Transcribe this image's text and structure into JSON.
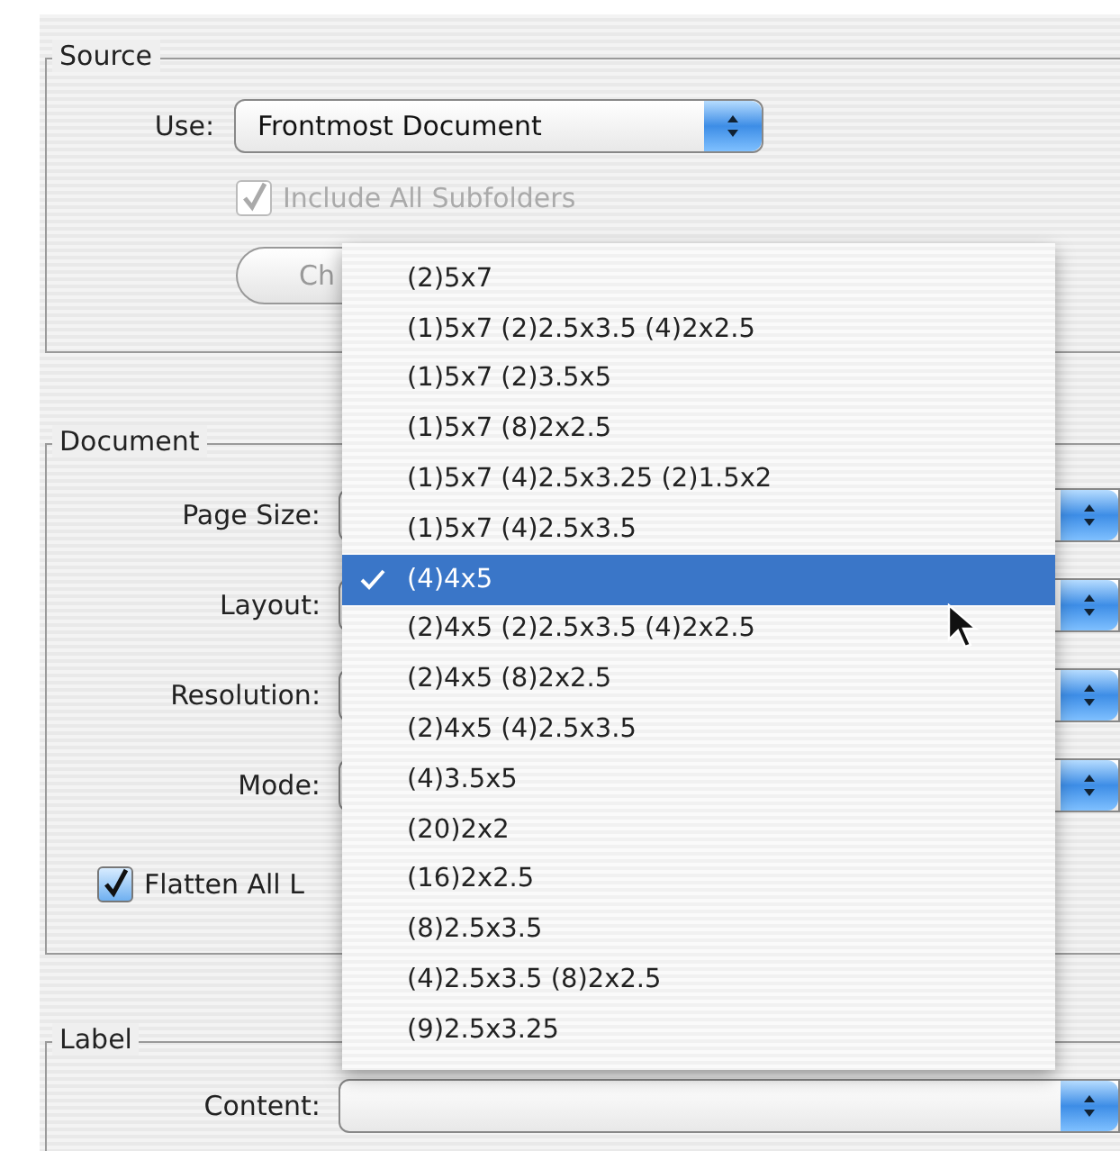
{
  "source": {
    "title": "Source",
    "use_label": "Use:",
    "use_value": "Frontmost Document",
    "include_subfolders": {
      "label": "Include All Subfolders",
      "checked": true,
      "disabled": true
    },
    "choose_button": "Ch"
  },
  "document": {
    "title": "Document",
    "fields": [
      {
        "label": "Page Size:"
      },
      {
        "label": "Layout:"
      },
      {
        "label": "Resolution:"
      },
      {
        "label": "Mode:"
      }
    ],
    "flatten": {
      "label": "Flatten All L",
      "checked": true,
      "disabled": false
    }
  },
  "label_group": {
    "title": "Label",
    "fields": [
      {
        "label": "Content:"
      }
    ]
  },
  "layout_menu": {
    "items": [
      {
        "label": "(2)5x7",
        "selected": false
      },
      {
        "label": "(1)5x7 (2)2.5x3.5 (4)2x2.5",
        "selected": false
      },
      {
        "label": "(1)5x7 (2)3.5x5",
        "selected": false
      },
      {
        "label": "(1)5x7 (8)2x2.5",
        "selected": false
      },
      {
        "label": "(1)5x7 (4)2.5x3.25 (2)1.5x2",
        "selected": false
      },
      {
        "label": "(1)5x7 (4)2.5x3.5",
        "selected": false
      },
      {
        "label": "(4)4x5",
        "selected": true
      },
      {
        "label": "(2)4x5 (2)2.5x3.5 (4)2x2.5",
        "selected": false
      },
      {
        "label": "(2)4x5 (8)2x2.5",
        "selected": false
      },
      {
        "label": "(2)4x5 (4)2.5x3.5",
        "selected": false
      },
      {
        "label": "(4)3.5x5",
        "selected": false
      },
      {
        "label": "(20)2x2",
        "selected": false
      },
      {
        "label": "(16)2x2.5",
        "selected": false
      },
      {
        "label": "(8)2.5x3.5",
        "selected": false
      },
      {
        "label": "(4)2.5x3.5 (8)2x2.5",
        "selected": false
      },
      {
        "label": "(9)2.5x3.25",
        "selected": false
      }
    ]
  }
}
